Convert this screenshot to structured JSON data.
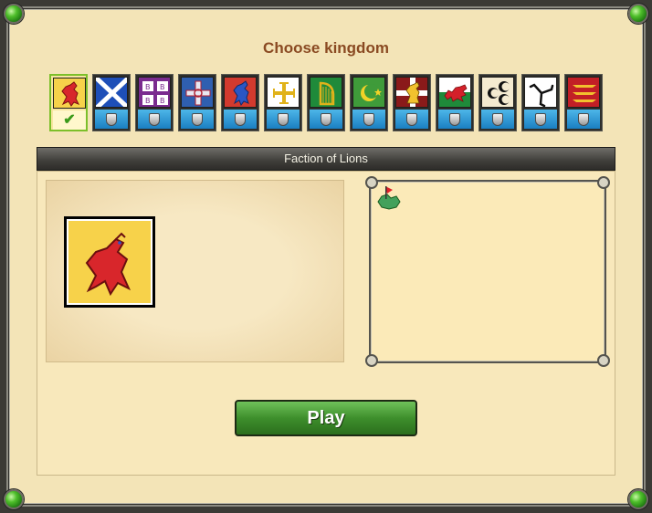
{
  "dialog": {
    "title": "Choose kingdom",
    "faction_name": "Faction of Lions",
    "play_label": "Play"
  },
  "kingdoms": [
    {
      "name": "lions",
      "selected": true,
      "locked": false
    },
    {
      "name": "scotland",
      "selected": false,
      "locked": true
    },
    {
      "name": "byzantine-cross",
      "selected": false,
      "locked": true
    },
    {
      "name": "crusader-cross",
      "selected": false,
      "locked": true
    },
    {
      "name": "blue-lion",
      "selected": false,
      "locked": true
    },
    {
      "name": "jerusalem-cross",
      "selected": false,
      "locked": true
    },
    {
      "name": "harp",
      "selected": false,
      "locked": true
    },
    {
      "name": "crescent-star",
      "selected": false,
      "locked": true
    },
    {
      "name": "cross-lions",
      "selected": false,
      "locked": true
    },
    {
      "name": "welsh-dragon",
      "selected": false,
      "locked": true
    },
    {
      "name": "three-crescents",
      "selected": false,
      "locked": true
    },
    {
      "name": "triskelion",
      "selected": false,
      "locked": true
    },
    {
      "name": "three-lions",
      "selected": false,
      "locked": true
    }
  ],
  "colors": {
    "title": "#8a4a22",
    "play_button": "#3e8f2c",
    "frame": "#3b3a35",
    "parchment": "#f3e4b7"
  }
}
